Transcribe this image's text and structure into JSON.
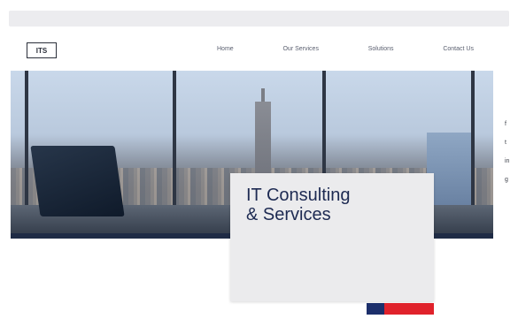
{
  "browser": {
    "url_text": ""
  },
  "header": {
    "logo_text": "ITS",
    "nav": [
      "Home",
      "Our Services",
      "Solutions",
      "Contact Us"
    ]
  },
  "side_icons": [
    "f",
    "t",
    "in",
    "g"
  ],
  "hero": {
    "title_line1": "IT Consulting",
    "title_line2": "& Services",
    "label": "",
    "paragraph": "",
    "cta_label": ""
  }
}
